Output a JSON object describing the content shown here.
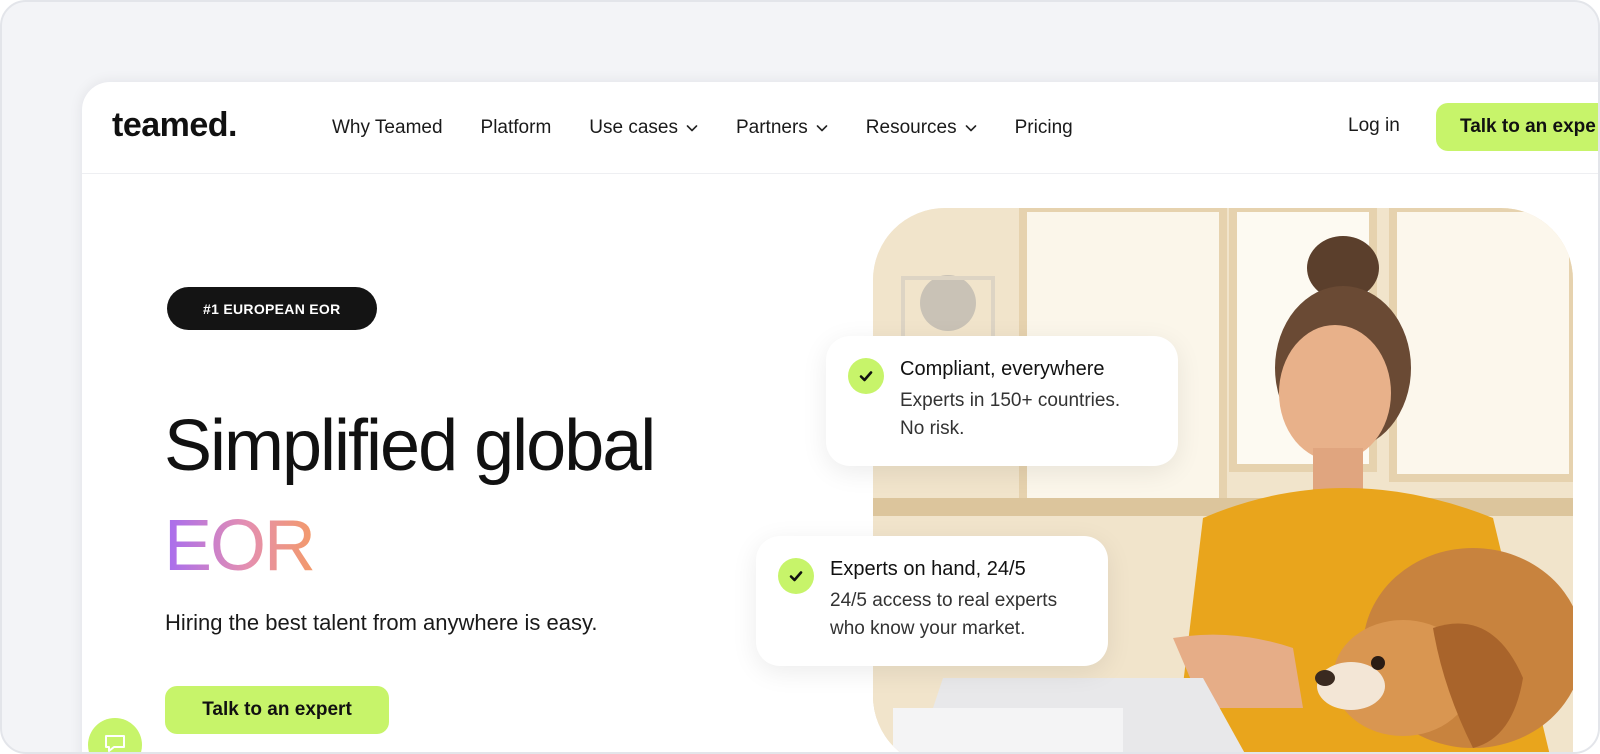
{
  "header": {
    "logo": "teamed.",
    "nav": [
      {
        "label": "Why Teamed",
        "dropdown": false
      },
      {
        "label": "Platform",
        "dropdown": false
      },
      {
        "label": "Use cases",
        "dropdown": true
      },
      {
        "label": "Partners",
        "dropdown": true
      },
      {
        "label": "Resources",
        "dropdown": true
      },
      {
        "label": "Pricing",
        "dropdown": false
      }
    ],
    "login_label": "Log in",
    "cta_label": "Talk to an expe"
  },
  "hero": {
    "badge": "#1 EUROPEAN EOR",
    "title_line1": "Simplified global",
    "title_line2": "EOR",
    "subtitle": "Hiring the best talent from anywhere is easy.",
    "cta_label": "Talk to an expert"
  },
  "cards": [
    {
      "title": "Compliant, everywhere",
      "line1": "Experts in 150+ countries.",
      "line2": "No risk."
    },
    {
      "title": "Experts on hand, 24/5",
      "line1": "24/5 access to real experts",
      "line2": "who know your market."
    }
  ],
  "colors": {
    "accent": "#c7f46a",
    "badge_bg": "#141414",
    "gradient_start": "#a66cf0",
    "gradient_end": "#f39a6a"
  },
  "icons": {
    "check": "check-icon",
    "chevron": "chevron-down-icon",
    "chat": "chat-icon"
  }
}
